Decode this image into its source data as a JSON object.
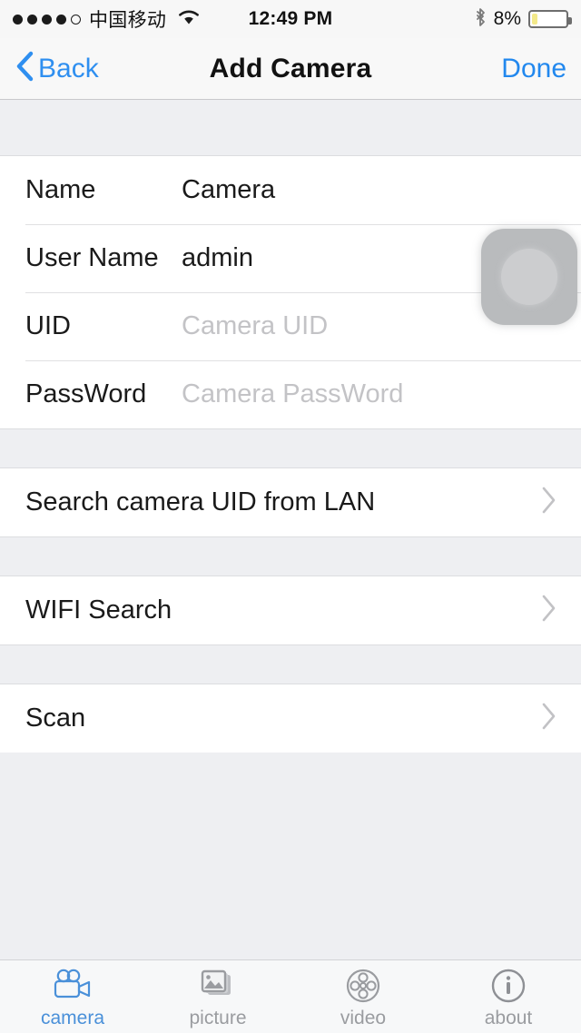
{
  "status_bar": {
    "signal_dots_filled": 4,
    "signal_dots_total": 5,
    "carrier": "中国移动",
    "wifi_icon": "wifi-icon",
    "time": "12:49 PM",
    "bluetooth_icon": "bluetooth-icon",
    "battery_percent": "8%",
    "battery_level": 8,
    "battery_fill_color": "#f3e98a"
  },
  "nav_bar": {
    "back_icon": "chevron-left-icon",
    "back_label": "Back",
    "title": "Add Camera",
    "done_label": "Done",
    "accent_color": "#2288ee"
  },
  "form": {
    "fields": [
      {
        "label": "Name",
        "value": "Camera",
        "placeholder": "",
        "is_placeholder": false
      },
      {
        "label": "User Name",
        "value": "admin",
        "placeholder": "",
        "is_placeholder": false
      },
      {
        "label": "UID",
        "value": "Camera UID",
        "placeholder": "Camera UID",
        "is_placeholder": true
      },
      {
        "label": "PassWord",
        "value": "Camera PassWord",
        "placeholder": "Camera PassWord",
        "is_placeholder": true
      }
    ]
  },
  "actions": [
    {
      "label": "Search camera UID from LAN",
      "chevron": "chevron-right-icon"
    },
    {
      "label": "WIFI Search",
      "chevron": "chevron-right-icon"
    },
    {
      "label": "Scan",
      "chevron": "chevron-right-icon"
    }
  ],
  "assistive_touch": {
    "icon": "assistive-touch-button",
    "color": "#b9bbbd"
  },
  "tab_bar": {
    "active_color": "#4a90d9",
    "inactive_color": "#9a9ca0",
    "tabs": [
      {
        "label": "camera",
        "icon": "movie-camera-icon",
        "active": true
      },
      {
        "label": "picture",
        "icon": "photo-stack-icon",
        "active": false
      },
      {
        "label": "video",
        "icon": "film-reel-icon",
        "active": false
      },
      {
        "label": "about",
        "icon": "info-circle-icon",
        "active": false
      }
    ]
  }
}
